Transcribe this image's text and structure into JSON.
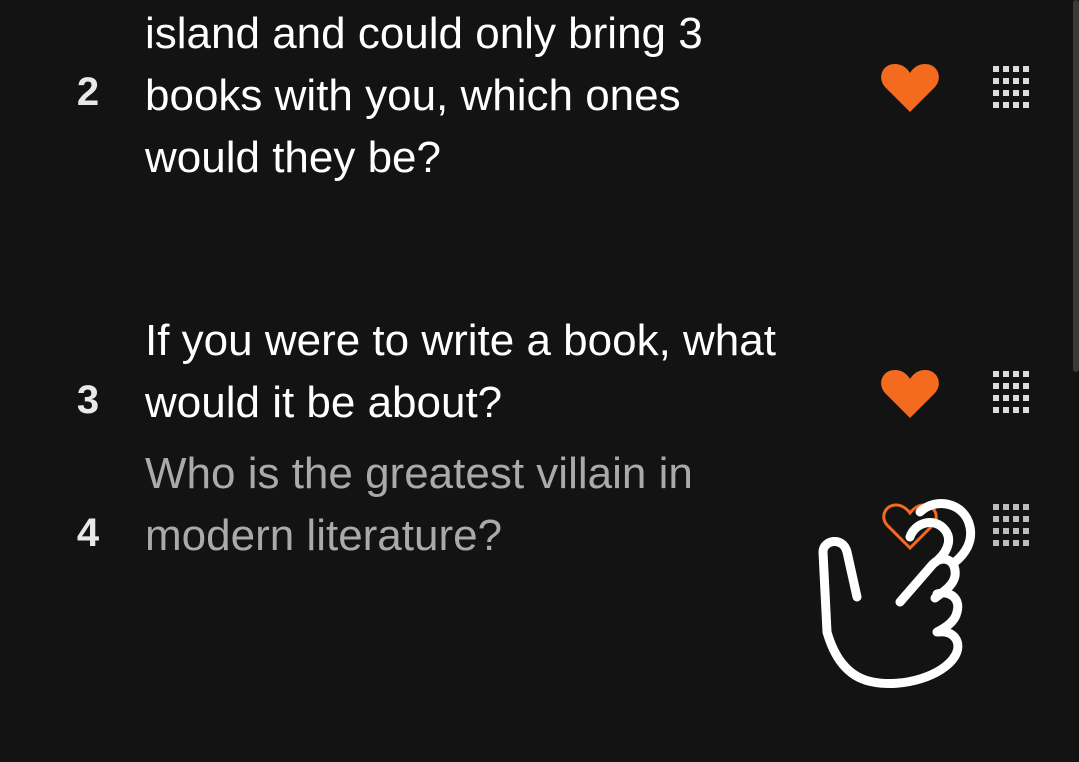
{
  "accent_color": "#f46a1f",
  "questions": [
    {
      "number": "2",
      "lines": [
        "island and could only bring 3",
        "books with you, which ones",
        "would they be?"
      ],
      "favorite_icon": "heart-filled-icon",
      "drag_icon": "drag-handle-icon"
    },
    {
      "number": "3",
      "lines": [
        "If you were to write a book, what",
        "would it be about?"
      ],
      "favorite_icon": "heart-filled-icon",
      "drag_icon": "drag-handle-icon"
    },
    {
      "number": "4",
      "lines": [
        "Who is the greatest villain in",
        "modern literature?"
      ],
      "favorite_icon": "heart-outline-icon",
      "drag_icon": "drag-handle-icon"
    }
  ],
  "overlay_icon": "tap-hand-icon"
}
